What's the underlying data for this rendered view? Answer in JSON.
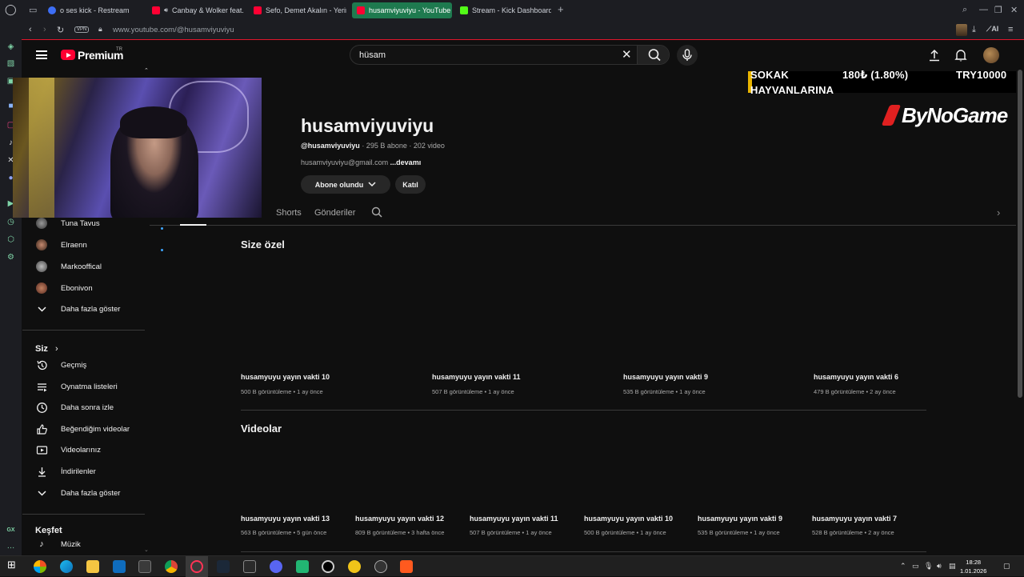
{
  "browser": {
    "tabs": [
      {
        "label": "o ses kick - Restream",
        "icon": "restream-icon"
      },
      {
        "label": "Canbay & Wolker feat.",
        "icon": "youtube-icon"
      },
      {
        "label": "Sefo, Demet Akalın - Yerin",
        "icon": "youtube-icon"
      },
      {
        "label": "husamviyuviyu - YouTube",
        "icon": "youtube-icon",
        "active": true
      },
      {
        "label": "Stream - Kick Dashboard",
        "icon": "kick-icon"
      }
    ],
    "url": "www.youtube.com/@husamviyuviyu",
    "vpn_label": "VPN",
    "ai_label": "AI",
    "accent_color": "#e0162b"
  },
  "youtube": {
    "brand": "Premium",
    "region": "TR",
    "search_value": "hüsam",
    "channel": {
      "name": "husamviyuviyu",
      "handle": "@husamviyuviyu",
      "meta": " · 295 B abone · 202 video",
      "email": "husamviyuviyu@gmail.com",
      "more": " ...devamı",
      "subscribe_label": "Abone olundu",
      "join_label": "Katıl"
    },
    "channel_tabs": [
      "Shorts",
      "Gönderiler"
    ],
    "guide": {
      "subscriptions": [
        "Tuna Tavus",
        "Elraenn",
        "Markooffical",
        "Ebonivon"
      ],
      "show_more": "Daha fazla göster",
      "you_title": "Siz",
      "you_items": [
        "Geçmiş",
        "Oynatma listeleri",
        "Daha sonra izle",
        "Beğendiğim videolar",
        "Videolarınız",
        "İndirilenler"
      ],
      "show_more_2": "Daha fazla göster",
      "explore_title": "Keşfet",
      "explore_items": [
        "Müzik"
      ]
    },
    "sections": {
      "for_you": {
        "title": "Size özel",
        "videos": [
          {
            "title": "husamyuyu yayın vakti 10",
            "meta": "500 B görüntüleme • 1 ay önce"
          },
          {
            "title": "husamyuyu yayın vakti 11",
            "meta": "507 B görüntüleme • 1 ay önce"
          },
          {
            "title": "husamyuyu yayın vakti 9",
            "meta": "535 B görüntüleme • 1 ay önce"
          },
          {
            "title": "husamyuyu yayın vakti 6",
            "meta": "479 B görüntüleme • 2 ay önce"
          }
        ]
      },
      "videos": {
        "title": "Videolar",
        "videos": [
          {
            "title": "husamyuyu yayın vakti 13",
            "meta": "563 B görüntüleme • 5 gün önce"
          },
          {
            "title": "husamyuyu yayın vakti 12",
            "meta": "809 B görüntüleme • 3 hafta önce"
          },
          {
            "title": "husamyuyu yayın vakti 11",
            "meta": "507 B görüntüleme • 1 ay önce"
          },
          {
            "title": "husamyuyu yayın vakti 10",
            "meta": "500 B görüntüleme • 1 ay önce"
          },
          {
            "title": "husamyuyu yayın vakti 9",
            "meta": "535 B görüntüleme • 1 ay önce"
          },
          {
            "title": "husamyuyu yayın vakti 7",
            "meta": "528 B görüntüleme • 2 ay önce"
          }
        ]
      }
    }
  },
  "overlay": {
    "donation_name_1": "SOKAK",
    "donation_name_2": "HAYVANLARINA",
    "donation_amount": "180₺ (1.80%)",
    "donation_goal": "TRY10000",
    "sponsor": "ByNoGame"
  },
  "taskbar": {
    "time": "18:28",
    "date": "1.01.2026"
  }
}
